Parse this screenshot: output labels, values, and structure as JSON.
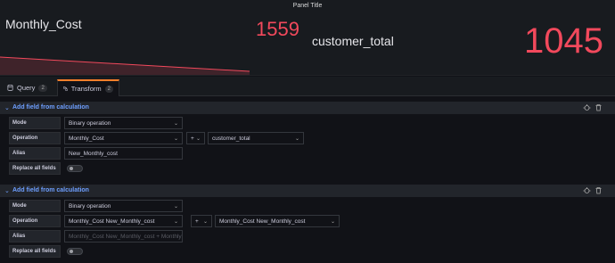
{
  "panel": {
    "title": "Panel Title",
    "stats": [
      {
        "name": "Monthly_Cost",
        "value": "1559"
      },
      {
        "name": "customer_total",
        "value": "1045"
      }
    ]
  },
  "tabs": [
    {
      "label": "Query",
      "count": "2",
      "icon": "database-icon"
    },
    {
      "label": "Transform",
      "count": "2",
      "icon": "transform-icon",
      "active": true
    }
  ],
  "transformations": [
    {
      "title": "Add field from calculation",
      "mode_label": "Mode",
      "mode_value": "Binary operation",
      "operation_label": "Operation",
      "left_field": "Monthly_Cost",
      "operator": "+",
      "right_field": "customer_total",
      "alias_label": "Alias",
      "alias_value": "New_Monthly_cost",
      "alias_placeholder": "",
      "replace_label": "Replace all fields",
      "replace_all": false
    },
    {
      "title": "Add field from calculation",
      "mode_label": "Mode",
      "mode_value": "Binary operation",
      "operation_label": "Operation",
      "left_field": "Monthly_Cost New_Monthly_cost",
      "operator": "+",
      "right_field": "Monthly_Cost New_Monthly_cost",
      "alias_label": "Alias",
      "alias_value": "",
      "alias_placeholder": "Monthly_Cost New_Monthly_cost + Monthly",
      "replace_label": "Replace all fields",
      "replace_all": false
    }
  ],
  "colors": {
    "stat_value": "#f2495c",
    "link_blue": "#6e9fff",
    "tab_active_accent": "#ff7f2a",
    "background": "#111217"
  }
}
